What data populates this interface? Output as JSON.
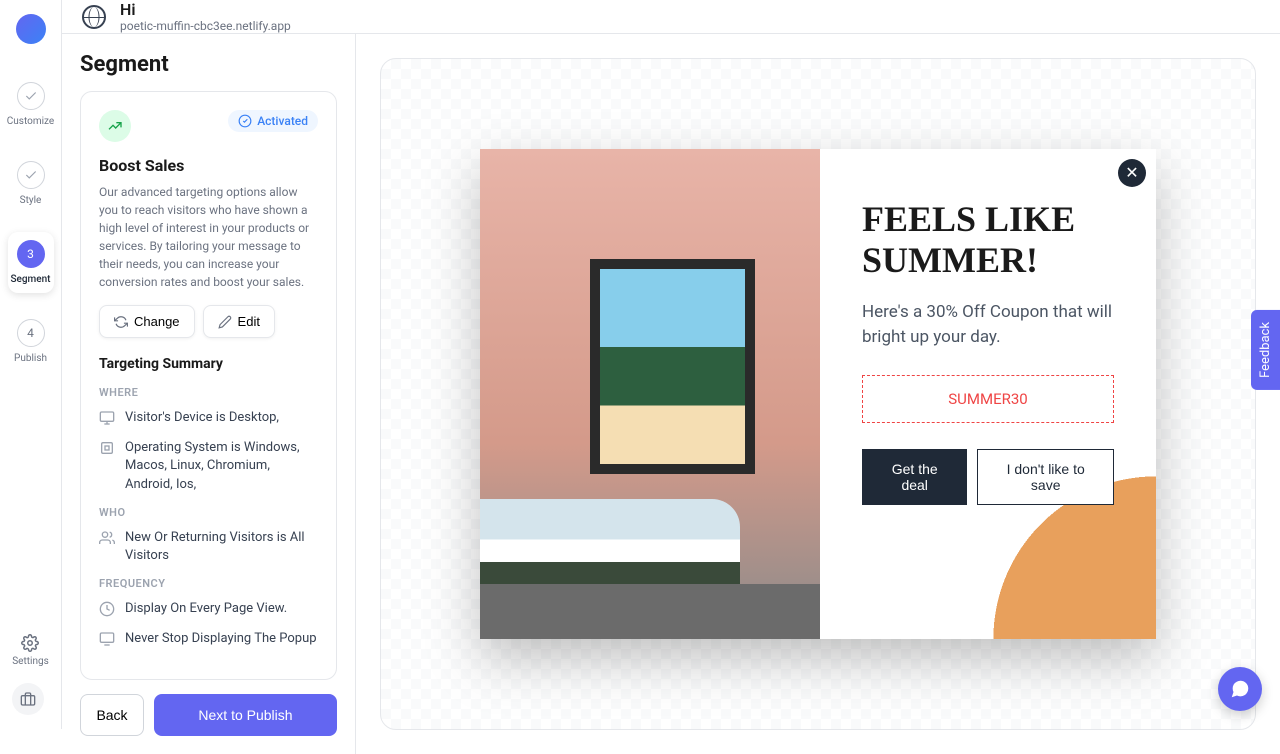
{
  "header": {
    "title": "Hi",
    "subtitle": "poetic-muffin-cbc3ee.netlify.app"
  },
  "nav": {
    "steps": [
      {
        "label": "Customize",
        "state": "done"
      },
      {
        "label": "Style",
        "state": "done"
      },
      {
        "label": "Segment",
        "state": "current",
        "number": "3"
      },
      {
        "label": "Publish",
        "state": "todo",
        "number": "4"
      }
    ],
    "settings_label": "Settings"
  },
  "panel": {
    "heading": "Segment",
    "segment": {
      "title": "Boost Sales",
      "badge": "Activated",
      "description": "Our advanced targeting options allow you to reach visitors who have shown a high level of interest in your products or services. By tailoring your message to their needs, you can increase your conversion rates and boost your sales.",
      "change_label": "Change",
      "edit_label": "Edit"
    },
    "targeting": {
      "heading": "Targeting Summary",
      "where_label": "WHERE",
      "where_items": [
        "Visitor's Device is Desktop,",
        "Operating System is Windows, Macos, Linux, Chromium, Android, Ios,"
      ],
      "who_label": "WHO",
      "who_items": [
        "New Or Returning Visitors is All Visitors"
      ],
      "frequency_label": "FREQUENCY",
      "frequency_items": [
        "Display On Every Page View.",
        "Never Stop Displaying The Popup"
      ]
    },
    "back_label": "Back",
    "next_label": "Next to Publish"
  },
  "popup": {
    "title": "FEELS LIKE SUMMER!",
    "subtitle": "Here's a 30% Off Coupon that will bright up your day.",
    "coupon": "SUMMER30",
    "cta_primary": "Get the deal",
    "cta_secondary": "I don't like to save"
  },
  "feedback_label": "Feedback"
}
